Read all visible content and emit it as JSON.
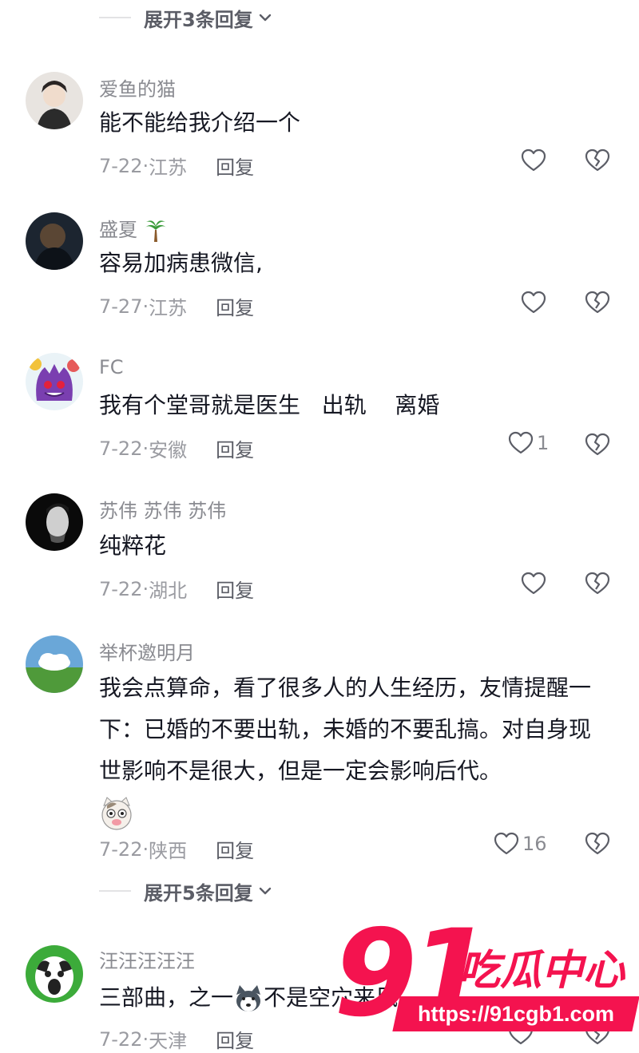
{
  "expand_top": {
    "label": "展开3条回复"
  },
  "expand_bottom": {
    "label": "展开5条回复"
  },
  "comments": [
    {
      "username": "爱鱼的猫",
      "text": "能不能给我介绍一个",
      "date": "7-22",
      "location": "江苏",
      "reply": "回复",
      "likes": ""
    },
    {
      "username": "盛夏",
      "username_emoji": "palm-tree",
      "text": "容易加病患微信,",
      "date": "7-27",
      "location": "江苏",
      "reply": "回复",
      "likes": ""
    },
    {
      "username": "FC",
      "text": "我有个堂哥就是医生   出轨    离婚",
      "date": "7-22",
      "location": "安徽",
      "reply": "回复",
      "likes": "1"
    },
    {
      "username": "苏伟 苏伟 苏伟",
      "text": "纯粹花",
      "date": "7-22",
      "location": "湖北",
      "reply": "回复",
      "likes": ""
    },
    {
      "username": "举杯邀明月",
      "text": "我会点算命，看了很多人的人生经历，友情提醒一下：已婚的不要出轨，未婚的不要乱搞。对自身现世影响不是很大，但是一定会影响后代。",
      "text_emoji": "cat-face",
      "date": "7-22",
      "location": "陕西",
      "reply": "回复",
      "likes": "16"
    },
    {
      "username": "汪汪汪汪汪",
      "text_part1": "三部曲，之一",
      "text_part2": "不是空穴来风",
      "text_emoji": "husky-dog",
      "date": "7-22",
      "location": "天津",
      "reply": "回复",
      "likes": ""
    }
  ],
  "meta_sep": "·",
  "watermark": {
    "number": "91",
    "name": "吃瓜中心",
    "url": "https://91cgb1.com"
  },
  "colors": {
    "text": "#161823",
    "secondary": "#8a8b91",
    "watermark": "#f4134f"
  }
}
